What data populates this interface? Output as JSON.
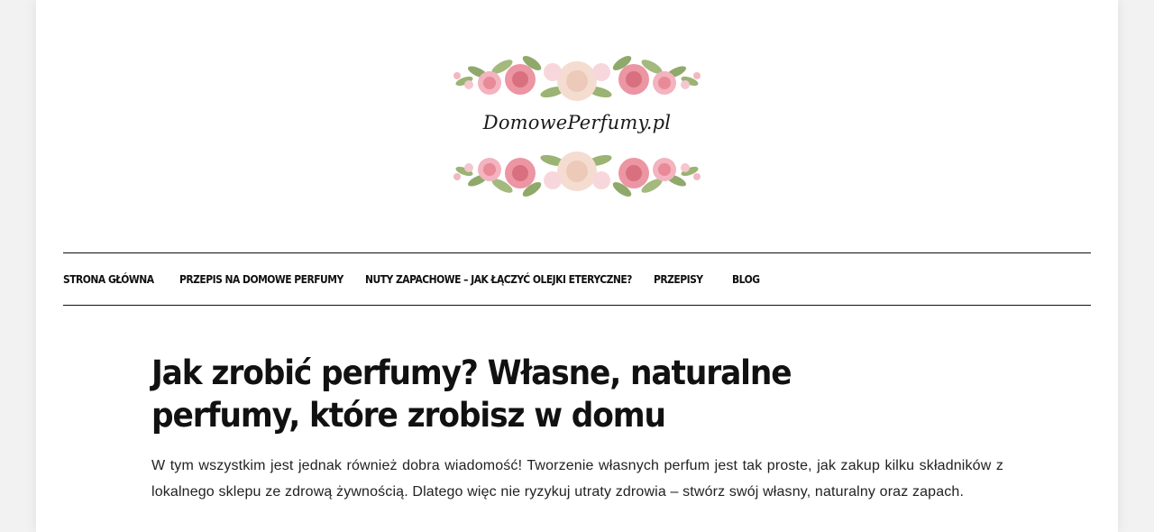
{
  "site": {
    "logo_text": "DomowePerfumy.pl"
  },
  "nav": {
    "items": [
      {
        "label": "STRONA GŁÓWNA"
      },
      {
        "label": "PRZEPIS NA DOMOWE PERFUMY"
      },
      {
        "label": "NUTY ZAPACHOWE – JAK ŁĄCZYĆ OLEJKI ETERYCZNE?"
      },
      {
        "label": "PRZEPISY"
      },
      {
        "label": "BLOG"
      }
    ]
  },
  "article": {
    "title": "Jak zrobić perfumy? Własne, naturalne perfumy, które zrobisz w domu",
    "body": "W tym wszystkim jest jednak również dobra wiadomość! Tworzenie własnych perfum jest tak proste, jak zakup kilku składników z lokalnego sklepu ze zdrową żywnością. Dlatego więc nie ryzykuj utraty zdrowia – stwórz swój własny, naturalny oraz zapach."
  },
  "colors": {
    "page_bg": "#f2f2f2",
    "content_bg": "#ffffff",
    "text": "#111111",
    "rose_pink": "#e88a98",
    "rose_cream": "#f4ddd0",
    "leaf_green": "#8fa96a"
  }
}
